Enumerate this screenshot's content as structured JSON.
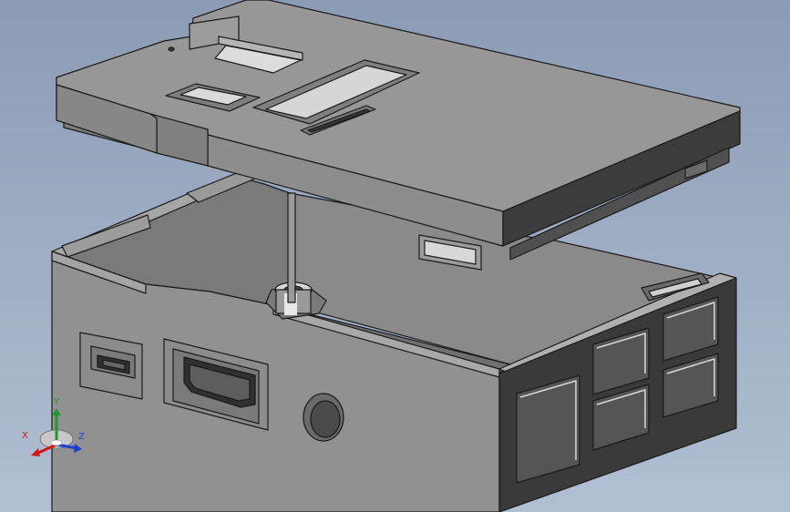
{
  "viewport": {
    "background_top": "#8c9bb4",
    "background_bottom": "#b1bfd3"
  },
  "model": {
    "part": "enclosure-case",
    "body_color": "#8f8f8f",
    "edge_color": "#1a1a1a",
    "lid": "case-lid-exploded"
  },
  "triad": {
    "x_label": "X",
    "y_label": "Y",
    "z_label": "Z",
    "x_color": "#d01818",
    "y_color": "#1f9a2a",
    "z_color": "#1f3fd0"
  }
}
